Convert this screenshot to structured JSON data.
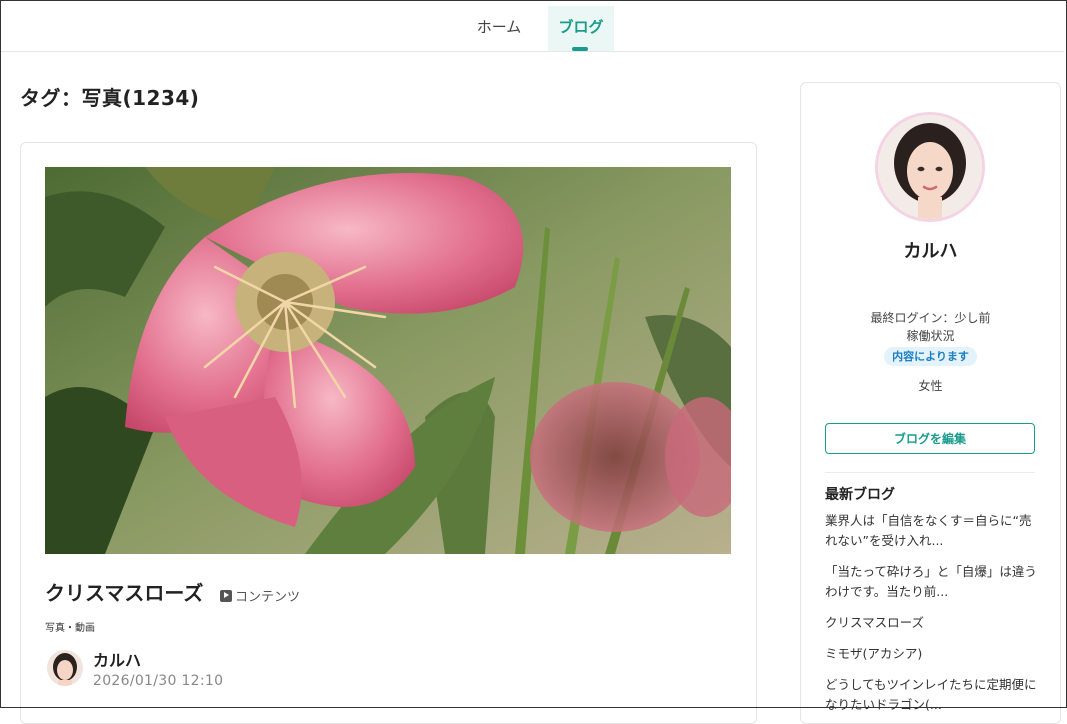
{
  "nav": {
    "home_label": "ホーム",
    "blog_label": "ブログ"
  },
  "page_title": "タグ：写真(1234)",
  "post": {
    "title": "クリスマスローズ",
    "content_badge": "コンテンツ",
    "category": "写真・動画",
    "author": "カルハ",
    "date": "2026/01/30 12:10"
  },
  "profile": {
    "name": "カルハ",
    "last_login": "最終ログイン：少し前",
    "status_label": "稼働状況",
    "status_badge": "内容によります",
    "gender": "女性",
    "edit_button": "ブログを編集"
  },
  "recent_blogs": {
    "heading": "最新ブログ",
    "items": [
      {
        "title": "業界人は「自信をなくす＝自らに“売れない”を受け入れ..."
      },
      {
        "title": "「当たって砕けろ」と「自爆」は違うわけです。当たり前..."
      },
      {
        "title": "クリスマスローズ"
      },
      {
        "title": "ミモザ(アカシア)"
      },
      {
        "title": "どうしてもツインレイたちに定期便になりたいドラゴン(..."
      }
    ]
  },
  "colors": {
    "accent": "#1a9c8c",
    "badge_bg": "#e4f2fb",
    "badge_text": "#1b7fc2"
  }
}
